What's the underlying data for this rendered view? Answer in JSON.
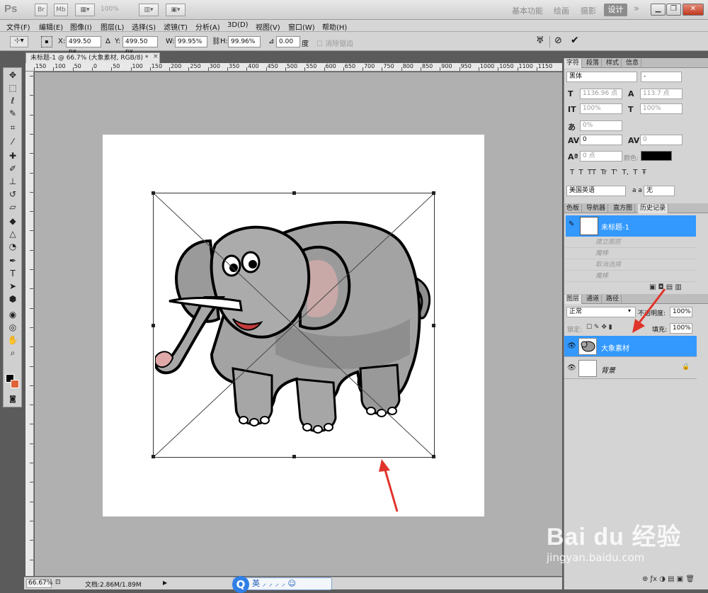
{
  "app": {
    "logo": "Ps",
    "zoom_readout": "100%",
    "workspaces": [
      "基本功能",
      "绘画",
      "摄影"
    ],
    "workspace_active": "设计",
    "more": "»"
  },
  "menu": [
    "文件(F)",
    "编辑(E)",
    "图像(I)",
    "图层(L)",
    "选择(S)",
    "滤镜(T)",
    "分析(A)",
    "3D(D)",
    "视图(V)",
    "窗口(W)",
    "帮助(H)"
  ],
  "options": {
    "x_label": "X:",
    "x_value": "499.50 px",
    "y_label": "Y:",
    "y_value": "499.50 px",
    "w_label": "W:",
    "w_value": "99.95%",
    "h_label": "H:",
    "h_value": "99.96%",
    "angle_value": "0.00",
    "angle_unit": "度",
    "interp_label": "消除锯齿"
  },
  "document": {
    "tab_title": "未标题-1 @ 66.7% (大象素材, RGB/8) *",
    "tab_close": "×",
    "ruler_ticks": [
      "150",
      "100",
      "50",
      "0",
      "50",
      "100",
      "150",
      "200",
      "250",
      "300",
      "350",
      "400",
      "450",
      "500",
      "550",
      "600",
      "650",
      "700",
      "750",
      "800",
      "850",
      "900",
      "950",
      "1000",
      "1050",
      "1100",
      "1150"
    ]
  },
  "status": {
    "zoom": "66.67%",
    "doc_size": "文档:2.86M/1.89M",
    "ime_logo": "Q",
    "ime_text": "英 ⸝ ⸝ ⸝ ⸝ ☺"
  },
  "panels": {
    "char_tabs": [
      "字符",
      "段落",
      "样式",
      "信息"
    ],
    "font_family": "黑体",
    "font_style": "-",
    "font_size": "1136.96 点",
    "leading": "113.7 点",
    "vscale": "100%",
    "hscale": "100%",
    "tsume": "0%",
    "kerning": "0",
    "tracking": "0",
    "baseline": "0 点",
    "color_label": "颜色:",
    "style_buttons": "T  T  TT  Tr  T'  T,  T  Ŧ",
    "language": "美国英语",
    "aa_label": "a a",
    "antialias": "无",
    "history_tabs": [
      "色板",
      "导航器",
      "直方图",
      "历史记录"
    ],
    "history_snapshot": "未标题-1",
    "history_items": [
      "建立图层",
      "魔棒",
      "取消选择",
      "魔棒"
    ],
    "layers_tabs": [
      "图层",
      "通道",
      "路径"
    ],
    "blend_mode": "正常",
    "opacity_label": "不透明度:",
    "opacity": "100%",
    "lock_label": "锁定:",
    "fill_label": "填充:",
    "fill": "100%",
    "layers": [
      {
        "name": "大象素材"
      },
      {
        "name": "背景"
      }
    ]
  },
  "watermark": {
    "brand": "Bai du 经验",
    "url": "jingyan.baidu.com"
  },
  "colors": {
    "selection_blue": "#3399ff",
    "annotation_red": "#e0342a"
  }
}
